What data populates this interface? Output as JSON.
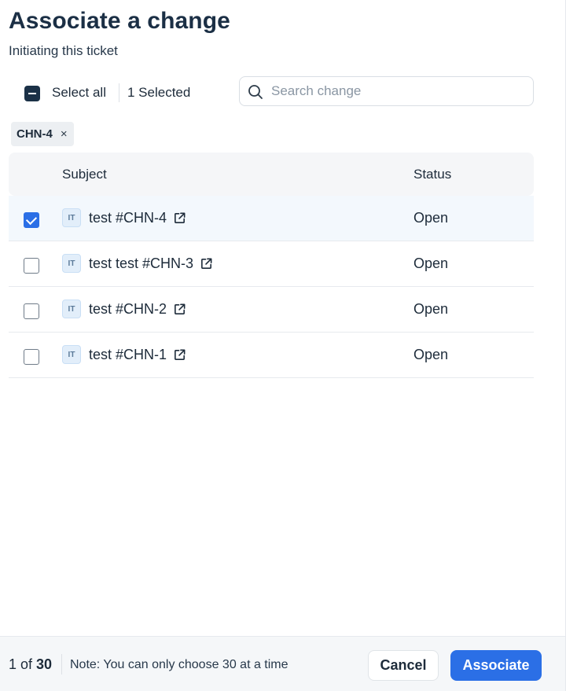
{
  "header": {
    "title": "Associate a change",
    "subtitle": "Initiating this ticket"
  },
  "toolbar": {
    "select_all_label": "Select all",
    "selected_count": "1 Selected",
    "search_placeholder": "Search change",
    "search_value": ""
  },
  "chips": [
    {
      "label": "CHN-4",
      "remove_icon": "×"
    }
  ],
  "table": {
    "columns": [
      "Subject",
      "Status"
    ],
    "rows": [
      {
        "checked": true,
        "badge": "IT",
        "subject": "test #CHN-4",
        "status": "Open"
      },
      {
        "checked": false,
        "badge": "IT",
        "subject": "test test #CHN-3",
        "status": "Open"
      },
      {
        "checked": false,
        "badge": "IT",
        "subject": "test #CHN-2",
        "status": "Open"
      },
      {
        "checked": false,
        "badge": "IT",
        "subject": "test #CHN-1",
        "status": "Open"
      }
    ]
  },
  "footer": {
    "count_prefix": "1 of ",
    "count_total": "30",
    "note": "Note: You can only choose 30 at a time",
    "cancel_label": "Cancel",
    "associate_label": "Associate"
  },
  "colors": {
    "accent": "#2b6fe6",
    "title": "#1b2f45",
    "indeterminate_checkbox": "#1b3147",
    "selected_row_bg": "#f3f8fd",
    "badge_bg": "#e2eefa"
  },
  "icons": {
    "search": "search-icon",
    "external_link": "external-link-icon",
    "remove_chip": "close-icon"
  }
}
